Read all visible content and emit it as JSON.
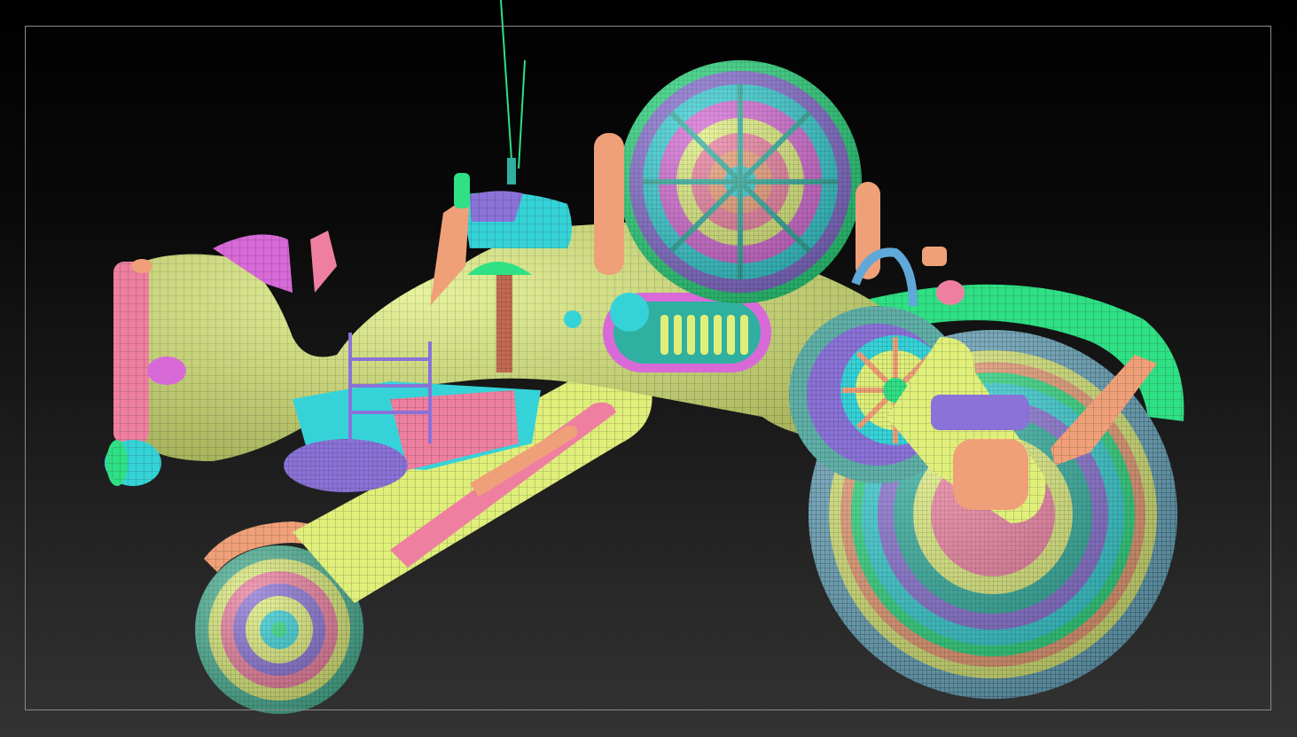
{
  "scene": {
    "subject": "steampunk-trike-wireframe-render",
    "palette": {
      "body": "#dfef7a",
      "pink": "#ef7fa0",
      "salmon": "#f0a078",
      "cyan": "#35d3d8",
      "green": "#2fe084",
      "violet": "#8a72d8",
      "magenta": "#d86ad8",
      "wire": "#2a2a2a",
      "frame": "#8a8a8a"
    }
  }
}
